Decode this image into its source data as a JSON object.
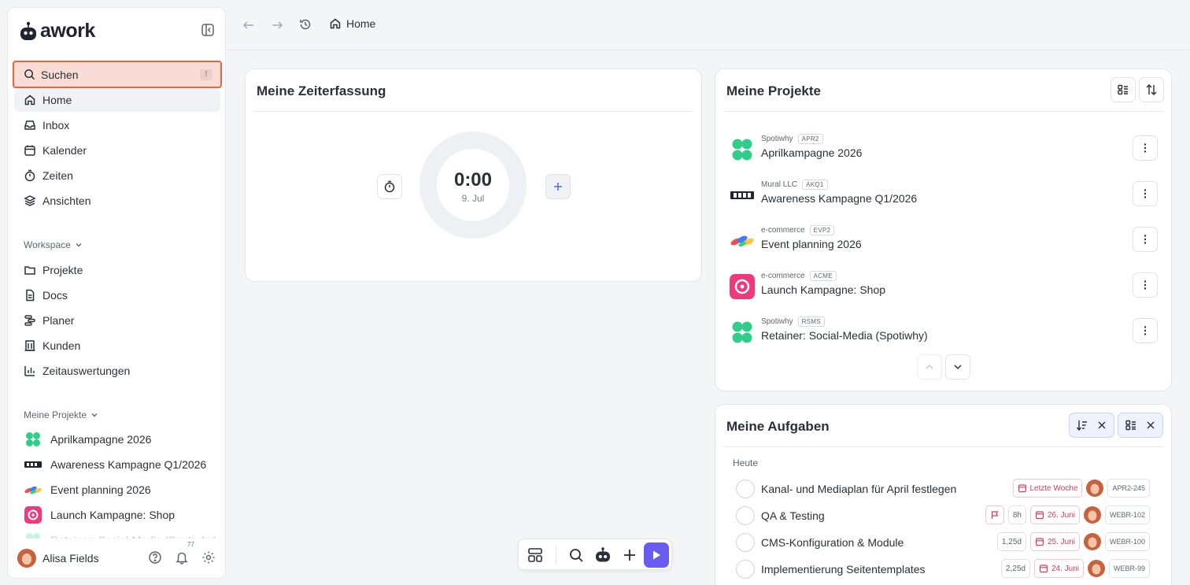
{
  "app": {
    "logo_text": "awork"
  },
  "sidebar": {
    "search": {
      "label": "Suchen",
      "shortcut": "f"
    },
    "nav": [
      {
        "label": "Home",
        "icon": "home-icon",
        "active": true
      },
      {
        "label": "Inbox",
        "icon": "inbox-icon"
      },
      {
        "label": "Kalender",
        "icon": "calendar-icon"
      },
      {
        "label": "Zeiten",
        "icon": "stopwatch-icon"
      },
      {
        "label": "Ansichten",
        "icon": "layers-icon"
      }
    ],
    "workspace_label": "Workspace",
    "workspace": [
      {
        "label": "Projekte",
        "icon": "folder-icon"
      },
      {
        "label": "Docs",
        "icon": "doc-icon"
      },
      {
        "label": "Planer",
        "icon": "planner-icon"
      },
      {
        "label": "Kunden",
        "icon": "building-icon"
      },
      {
        "label": "Zeitauswertungen",
        "icon": "chart-icon"
      }
    ],
    "my_projects_label": "Meine Projekte",
    "my_projects": [
      {
        "label": "Aprilkampagne 2026"
      },
      {
        "label": "Awareness Kampagne Q1/2026"
      },
      {
        "label": "Event planning 2026"
      },
      {
        "label": "Launch Kampagne: Shop"
      },
      {
        "label": "Retainer: Social-Media (Spotiwhy)"
      }
    ],
    "footer": {
      "user_name": "Alisa Fields",
      "notification_count": "77"
    }
  },
  "topbar": {
    "breadcrumb": "Home"
  },
  "time_card": {
    "title": "Meine Zeiterfassung",
    "time": "0:00",
    "date": "9. Jul"
  },
  "projects_card": {
    "title": "Meine Projekte",
    "items": [
      {
        "customer": "Spotiwhy",
        "tag": "APR2",
        "name": "Aprilkampagne 2026"
      },
      {
        "customer": "Mural LLC",
        "tag": "AKQ1",
        "name": "Awareness Kampagne Q1/2026"
      },
      {
        "customer": "e-commerce",
        "tag": "EVP2",
        "name": "Event planning 2026"
      },
      {
        "customer": "e-commerce",
        "tag": "ACME",
        "name": "Launch Kampagne: Shop"
      },
      {
        "customer": "Spotiwhy",
        "tag": "RSMS",
        "name": "Retainer: Social-Media (Spotiwhy)"
      }
    ]
  },
  "tasks_card": {
    "title": "Meine Aufgaben",
    "group_label": "Heute",
    "items": [
      {
        "name": "Kanal- und Mediaplan für April festlegen",
        "effort": "",
        "due": "Letzte Woche",
        "key": "APR2-245"
      },
      {
        "name": "QA & Testing",
        "effort": "8h",
        "due": "26. Juni",
        "key": "WEBR-102"
      },
      {
        "name": "CMS-Konfiguration & Module",
        "effort": "1,25d",
        "due": "25. Juni",
        "key": "WEBR-100"
      },
      {
        "name": "Implementierung Seitentemplates",
        "effort": "2,25d",
        "due": "24. Juni",
        "key": "WEBR-99"
      }
    ]
  },
  "colors": {
    "accent": "#e8663f",
    "play": "#6b5cf0",
    "due_red": "#e0385f"
  }
}
